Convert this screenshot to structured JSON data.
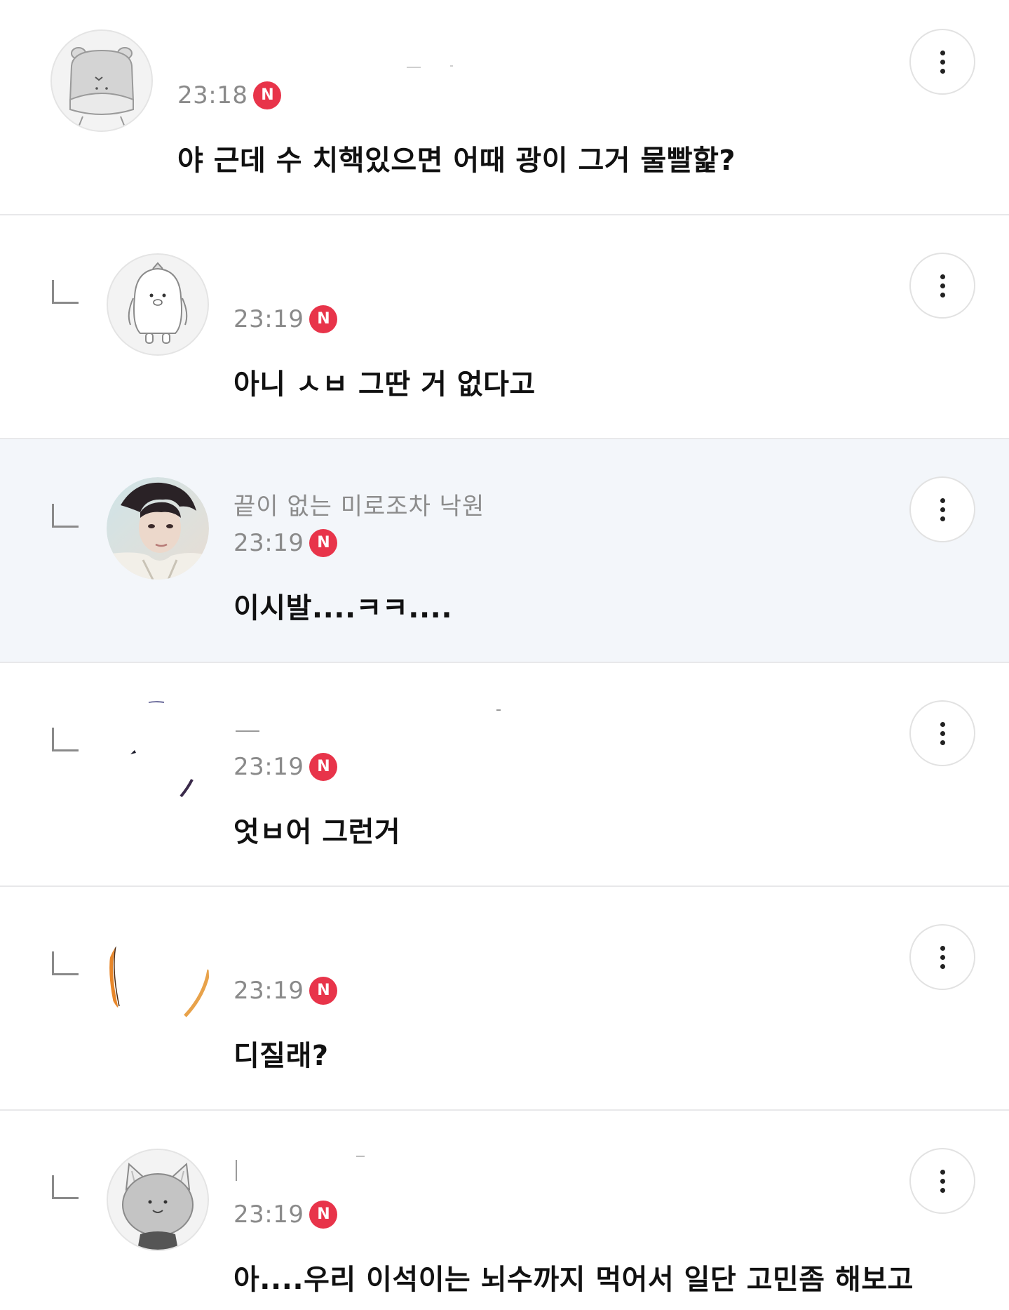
{
  "comments": [
    {
      "type": "comment",
      "avatar": "hippo-avatar",
      "nickname": "",
      "time": "23:18",
      "badge": "N",
      "text": "야 근데 수 치핵있으면 어때 광이 그거 물빨핥?"
    },
    {
      "type": "reply",
      "avatar": "penguin-avatar",
      "nickname": "",
      "time": "23:19",
      "badge": "N",
      "text": "아니 ㅅㅂ 그딴 거 없다고"
    },
    {
      "type": "reply",
      "avatar": "photo-avatar",
      "nickname": "끝이 없는 미로조차 낙원",
      "time": "23:19",
      "badge": "N",
      "text": "이시발....ㅋㅋ....",
      "highlighted": true
    },
    {
      "type": "reply",
      "avatar": "hidden-avatar",
      "nickname": "",
      "time": "23:19",
      "badge": "N",
      "text": "엇ㅂ어 그런거"
    },
    {
      "type": "reply",
      "avatar": "hidden-avatar",
      "nickname": "",
      "time": "23:19",
      "badge": "N",
      "text": "디질래?"
    },
    {
      "type": "reply",
      "avatar": "cat-avatar",
      "nickname": "",
      "time": "23:19",
      "badge": "N",
      "text": "아....우리 이석이는 뇌수까지 먹어서 일단 고민좀 해보고"
    }
  ],
  "icons": {
    "more": "more-vertical-icon",
    "reply": "reply-arrow-icon"
  },
  "colors": {
    "badge": "#e8344a",
    "highlight_bg": "#f3f6fa",
    "divider": "#e8e8ea",
    "time": "#8a8a8a"
  }
}
